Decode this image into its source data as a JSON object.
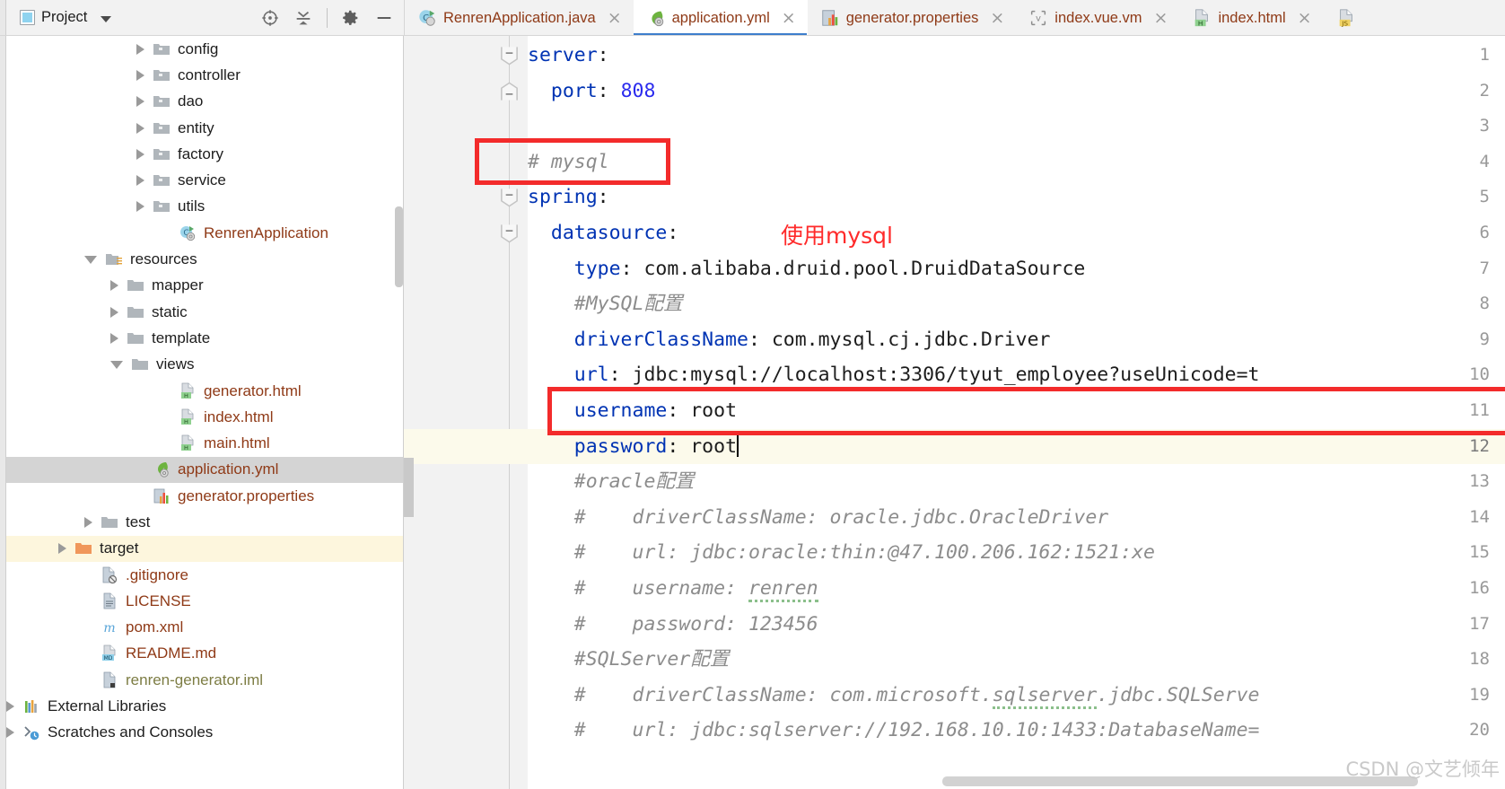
{
  "toolwindow": {
    "title": "Project",
    "icons": [
      "project-view-icon",
      "locate-icon",
      "collapse-all-icon",
      "gear-icon",
      "minimize-icon"
    ]
  },
  "tabs": [
    {
      "label": "RenrenApplication.java",
      "icon": "java-class-run-icon",
      "active": false,
      "close": "×"
    },
    {
      "label": "application.yml",
      "icon": "spring-yaml-icon",
      "active": true,
      "close": "×"
    },
    {
      "label": "generator.properties",
      "icon": "properties-icon",
      "active": false,
      "close": "×"
    },
    {
      "label": "index.vue.vm",
      "icon": "velocity-icon",
      "active": false,
      "close": "×"
    },
    {
      "label": "index.html",
      "icon": "html-icon",
      "active": false,
      "close": "×"
    },
    {
      "label": "",
      "icon": "js-icon",
      "active": false,
      "close": ""
    }
  ],
  "tree": [
    {
      "label": "config",
      "icon": "folder-package-icon",
      "arrow": "closed",
      "indent": 5,
      "color": "dark",
      "state": ""
    },
    {
      "label": "controller",
      "icon": "folder-package-icon",
      "arrow": "closed",
      "indent": 5,
      "color": "dark",
      "state": ""
    },
    {
      "label": "dao",
      "icon": "folder-package-icon",
      "arrow": "closed",
      "indent": 5,
      "color": "dark",
      "state": ""
    },
    {
      "label": "entity",
      "icon": "folder-package-icon",
      "arrow": "closed",
      "indent": 5,
      "color": "dark",
      "state": ""
    },
    {
      "label": "factory",
      "icon": "folder-package-icon",
      "arrow": "closed",
      "indent": 5,
      "color": "dark",
      "state": ""
    },
    {
      "label": "service",
      "icon": "folder-package-icon",
      "arrow": "closed",
      "indent": 5,
      "color": "dark",
      "state": ""
    },
    {
      "label": "utils",
      "icon": "folder-package-icon",
      "arrow": "closed",
      "indent": 5,
      "color": "dark",
      "state": ""
    },
    {
      "label": "RenrenApplication",
      "icon": "java-class-run-icon",
      "arrow": "none",
      "indent": 6,
      "color": "orange",
      "state": ""
    },
    {
      "label": "resources",
      "icon": "folder-resources-icon",
      "arrow": "open",
      "indent": 3,
      "color": "dark",
      "state": ""
    },
    {
      "label": "mapper",
      "icon": "folder-icon",
      "arrow": "closed",
      "indent": 4,
      "color": "dark",
      "state": ""
    },
    {
      "label": "static",
      "icon": "folder-icon",
      "arrow": "closed",
      "indent": 4,
      "color": "dark",
      "state": ""
    },
    {
      "label": "template",
      "icon": "folder-icon",
      "arrow": "closed",
      "indent": 4,
      "color": "dark",
      "state": ""
    },
    {
      "label": "views",
      "icon": "folder-icon",
      "arrow": "open",
      "indent": 4,
      "color": "dark",
      "state": ""
    },
    {
      "label": "generator.html",
      "icon": "html-icon",
      "arrow": "none",
      "indent": 6,
      "color": "orange",
      "state": ""
    },
    {
      "label": "index.html",
      "icon": "html-icon",
      "arrow": "none",
      "indent": 6,
      "color": "orange",
      "state": ""
    },
    {
      "label": "main.html",
      "icon": "html-icon",
      "arrow": "none",
      "indent": 6,
      "color": "orange",
      "state": ""
    },
    {
      "label": "application.yml",
      "icon": "spring-yaml-icon",
      "arrow": "none",
      "indent": 5,
      "color": "orange",
      "state": "selected"
    },
    {
      "label": "generator.properties",
      "icon": "properties-icon",
      "arrow": "none",
      "indent": 5,
      "color": "orange",
      "state": ""
    },
    {
      "label": "test",
      "icon": "folder-icon",
      "arrow": "closed",
      "indent": 3,
      "color": "dark",
      "state": ""
    },
    {
      "label": "target",
      "icon": "folder-excluded-icon",
      "arrow": "closed",
      "indent": 2,
      "color": "dark",
      "state": "highlight"
    },
    {
      "label": ".gitignore",
      "icon": "gitignore-icon",
      "arrow": "none",
      "indent": 3,
      "color": "orange",
      "state": ""
    },
    {
      "label": "LICENSE",
      "icon": "text-file-icon",
      "arrow": "none",
      "indent": 3,
      "color": "orange",
      "state": ""
    },
    {
      "label": "pom.xml",
      "icon": "maven-icon",
      "arrow": "none",
      "indent": 3,
      "color": "orange",
      "state": ""
    },
    {
      "label": "README.md",
      "icon": "markdown-icon",
      "arrow": "none",
      "indent": 3,
      "color": "orange",
      "state": ""
    },
    {
      "label": "renren-generator.iml",
      "icon": "iml-module-icon",
      "arrow": "none",
      "indent": 3,
      "color": "olive",
      "state": ""
    },
    {
      "label": "External Libraries",
      "icon": "libraries-icon",
      "arrow": "closed",
      "indent": 0,
      "color": "dark",
      "state": ""
    },
    {
      "label": "Scratches and Consoles",
      "icon": "scratches-icon",
      "arrow": "closed",
      "indent": 0,
      "color": "dark",
      "state": ""
    }
  ],
  "editor": {
    "file": "application.yml",
    "current_line": 12,
    "lines": [
      {
        "n": 1,
        "fold": "collapse-down",
        "tokens": [
          {
            "t": "server",
            "c": "k"
          },
          {
            "t": ":",
            "c": "v"
          }
        ]
      },
      {
        "n": 2,
        "fold": "collapse-end",
        "tokens": [
          {
            "t": "  ",
            "c": "v"
          },
          {
            "t": "port",
            "c": "k"
          },
          {
            "t": ": ",
            "c": "v"
          },
          {
            "t": "808",
            "c": "num"
          }
        ]
      },
      {
        "n": 3,
        "fold": "",
        "tokens": []
      },
      {
        "n": 4,
        "fold": "",
        "tokens": [
          {
            "t": "# mysql",
            "c": "cmt"
          }
        ]
      },
      {
        "n": 5,
        "fold": "collapse-down",
        "tokens": [
          {
            "t": "spring",
            "c": "k"
          },
          {
            "t": ":",
            "c": "v"
          }
        ]
      },
      {
        "n": 6,
        "fold": "collapse-down",
        "tokens": [
          {
            "t": "  ",
            "c": "v"
          },
          {
            "t": "datasource",
            "c": "k"
          },
          {
            "t": ":",
            "c": "v"
          }
        ]
      },
      {
        "n": 7,
        "fold": "",
        "tokens": [
          {
            "t": "    ",
            "c": "v"
          },
          {
            "t": "type",
            "c": "k"
          },
          {
            "t": ": com.alibaba.druid.pool.DruidDataSource",
            "c": "v"
          }
        ]
      },
      {
        "n": 8,
        "fold": "",
        "tokens": [
          {
            "t": "    #MySQL配置",
            "c": "cmt"
          }
        ]
      },
      {
        "n": 9,
        "fold": "",
        "tokens": [
          {
            "t": "    ",
            "c": "v"
          },
          {
            "t": "driverClassName",
            "c": "k"
          },
          {
            "t": ": com.mysql.cj.jdbc.Driver",
            "c": "v"
          }
        ]
      },
      {
        "n": 10,
        "fold": "",
        "tokens": [
          {
            "t": "    ",
            "c": "v"
          },
          {
            "t": "url",
            "c": "k"
          },
          {
            "t": ": jdbc:mysql://localhost:3306/tyut_employee?useUnicode=t",
            "c": "v"
          }
        ]
      },
      {
        "n": 11,
        "fold": "",
        "tokens": [
          {
            "t": "    ",
            "c": "v"
          },
          {
            "t": "username",
            "c": "k"
          },
          {
            "t": ": root",
            "c": "v"
          }
        ]
      },
      {
        "n": 12,
        "fold": "",
        "tokens": [
          {
            "t": "    ",
            "c": "v"
          },
          {
            "t": "password",
            "c": "k"
          },
          {
            "t": ": root",
            "c": "v"
          }
        ]
      },
      {
        "n": 13,
        "fold": "",
        "tokens": [
          {
            "t": "    #oracle配置",
            "c": "cmt"
          }
        ]
      },
      {
        "n": 14,
        "fold": "",
        "tokens": [
          {
            "t": "    #    driverClassName: oracle.jdbc.OracleDriver",
            "c": "cmt"
          }
        ]
      },
      {
        "n": 15,
        "fold": "",
        "tokens": [
          {
            "t": "    #    url: jdbc:oracle:thin:@47.100.206.162:1521:xe",
            "c": "cmt"
          }
        ]
      },
      {
        "n": 16,
        "fold": "",
        "tokens": [
          {
            "t": "    #    username: ",
            "c": "cmt"
          },
          {
            "t": "renren",
            "c": "cmt squig"
          }
        ]
      },
      {
        "n": 17,
        "fold": "",
        "tokens": [
          {
            "t": "    #    password: 123456",
            "c": "cmt"
          }
        ]
      },
      {
        "n": 18,
        "fold": "",
        "tokens": [
          {
            "t": "    #SQLServer配置",
            "c": "cmt"
          }
        ]
      },
      {
        "n": 19,
        "fold": "",
        "tokens": [
          {
            "t": "    #    driverClassName: com.microsoft.",
            "c": "cmt"
          },
          {
            "t": "sqlserver",
            "c": "cmt squig"
          },
          {
            "t": ".jdbc.SQLServe",
            "c": "cmt"
          }
        ]
      },
      {
        "n": 20,
        "fold": "",
        "tokens": [
          {
            "t": "    #    url: jdbc:sqlserver://192.168.10.10:1433:DatabaseName=",
            "c": "cmt"
          }
        ]
      }
    ],
    "annotation": "使用mysql",
    "highlight_color": "#f32b2b"
  },
  "watermark": "CSDN @文艺倾年"
}
